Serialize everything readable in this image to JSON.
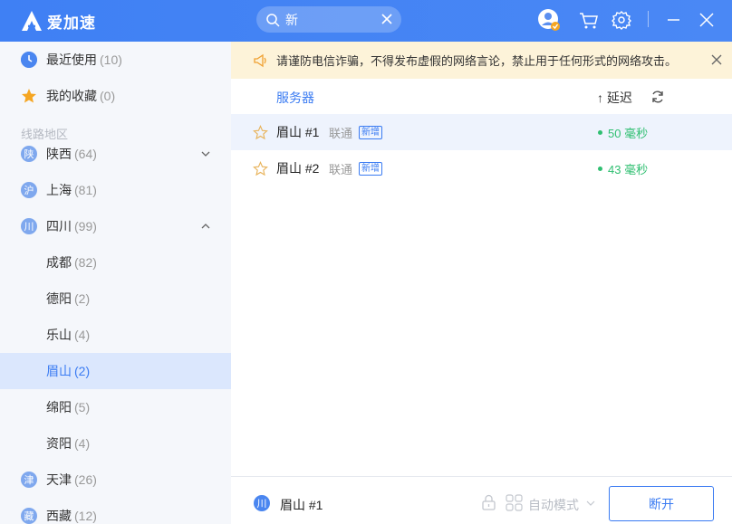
{
  "app": {
    "title": "爱加速"
  },
  "search": {
    "value": "新"
  },
  "sidebar": {
    "recent": {
      "label": "最近使用",
      "count": "(10)"
    },
    "favorites": {
      "label": "我的收藏",
      "count": "(0)"
    },
    "section_label": "线路地区",
    "regions": [
      {
        "badge": "陕",
        "label": "陕西",
        "count": "(64)"
      },
      {
        "badge": "沪",
        "label": "上海",
        "count": "(81)"
      },
      {
        "badge": "川",
        "label": "四川",
        "count": "(99)"
      },
      {
        "badge": "津",
        "label": "天津",
        "count": "(26)"
      },
      {
        "badge": "藏",
        "label": "西藏",
        "count": "(12)"
      }
    ],
    "cities": [
      {
        "label": "成都",
        "count": "(82)"
      },
      {
        "label": "德阳",
        "count": "(2)"
      },
      {
        "label": "乐山",
        "count": "(4)"
      },
      {
        "label": "眉山",
        "count": "(2)"
      },
      {
        "label": "绵阳",
        "count": "(5)"
      },
      {
        "label": "资阳",
        "count": "(4)"
      }
    ]
  },
  "notice": {
    "text": "请谨防电信诈骗，不得发布虚假的网络言论，禁止用于任何形式的网络攻击。"
  },
  "list": {
    "header_server": "服务器",
    "header_latency": "↑ 延迟",
    "rows": [
      {
        "name": "眉山 #1",
        "isp": "联通",
        "badge": "新增",
        "latency": "50 毫秒"
      },
      {
        "name": "眉山 #2",
        "isp": "联通",
        "badge": "新增",
        "latency": "43 毫秒"
      }
    ]
  },
  "footer": {
    "badge": "川",
    "current": "眉山 #1",
    "mode": "自动模式",
    "disconnect": "断开"
  },
  "colors": {
    "accent": "#3a7bf2",
    "latency_good": "#2fbf71",
    "notice_bg": "#fdf3d9"
  }
}
